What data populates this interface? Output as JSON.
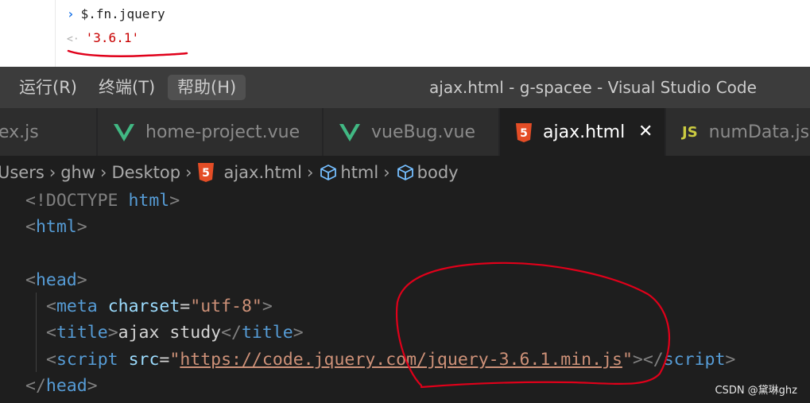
{
  "console": {
    "input": "$.fn.jquery",
    "output": "'3.6.1'"
  },
  "menu": {
    "items": [
      {
        "label": "运行(R)"
      },
      {
        "label": "终端(T)"
      },
      {
        "label": "帮助(H)"
      }
    ]
  },
  "window": {
    "title": "ajax.html - g-spacee - Visual Studio Code"
  },
  "tabs": [
    {
      "label": "ex.js",
      "icon": "js-file-icon"
    },
    {
      "label": "home-project.vue",
      "icon": "vue-icon"
    },
    {
      "label": "vueBug.vue",
      "icon": "vue-icon"
    },
    {
      "label": "ajax.html",
      "icon": "html5-icon",
      "active": true
    },
    {
      "label": "numData.js",
      "icon": "js-icon"
    }
  ],
  "tab_close_glyph": "✕",
  "js_icon_text": "JS",
  "breadcrumb": {
    "items": [
      "Users",
      "ghw",
      "Desktop",
      "ajax.html",
      "html",
      "body"
    ],
    "separator": "›"
  },
  "code": {
    "doctype_open": "<!DOCTYPE",
    "doctype_name": "html",
    "html_open": "html",
    "head_open": "head",
    "meta_tag": "meta",
    "meta_attr": "charset",
    "meta_value": "\"utf-8\"",
    "title_tag": "title",
    "title_text": "ajax study",
    "script_tag": "script",
    "script_attr": "src",
    "script_url": "https://code.jquery.com/jquery-3.6.1.min.js",
    "head_close": "head"
  },
  "watermark": "CSDN @黛琳ghz",
  "colors": {
    "annotation": "#e0001a",
    "editor_bg": "#1e1e1e",
    "menubar_bg": "#3c3c3c",
    "tag": "#569cd6",
    "attribute": "#9cdcfe",
    "string": "#ce9178"
  }
}
